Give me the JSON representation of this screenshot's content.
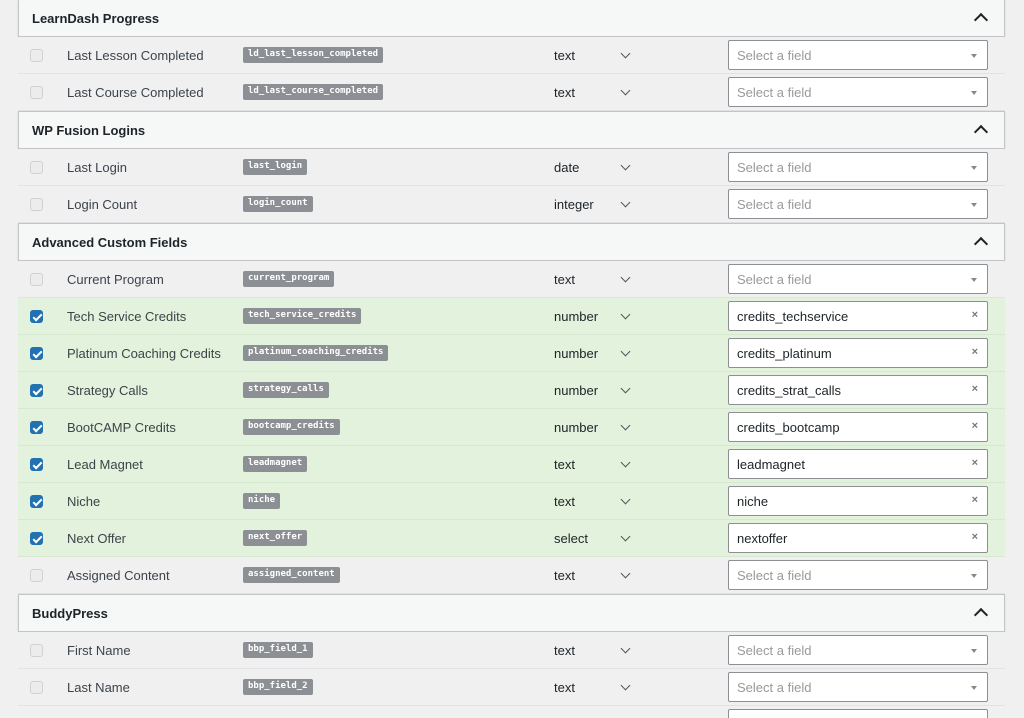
{
  "placeholder": "Select a field",
  "sections": [
    {
      "title": "LearnDash Progress",
      "rows": [
        {
          "label": "Last Lesson Completed",
          "key": "ld_last_lesson_completed",
          "type": "text",
          "checked": false,
          "value": ""
        },
        {
          "label": "Last Course Completed",
          "key": "ld_last_course_completed",
          "type": "text",
          "checked": false,
          "value": ""
        }
      ]
    },
    {
      "title": "WP Fusion Logins",
      "rows": [
        {
          "label": "Last Login",
          "key": "last_login",
          "type": "date",
          "checked": false,
          "value": ""
        },
        {
          "label": "Login Count",
          "key": "login_count",
          "type": "integer",
          "checked": false,
          "value": ""
        }
      ]
    },
    {
      "title": "Advanced Custom Fields",
      "rows": [
        {
          "label": "Current Program",
          "key": "current_program",
          "type": "text",
          "checked": false,
          "value": ""
        },
        {
          "label": "Tech Service Credits",
          "key": "tech_service_credits",
          "type": "number",
          "checked": true,
          "value": "credits_techservice"
        },
        {
          "label": "Platinum Coaching Credits",
          "key": "platinum_coaching_credits",
          "type": "number",
          "checked": true,
          "value": "credits_platinum"
        },
        {
          "label": "Strategy Calls",
          "key": "strategy_calls",
          "type": "number",
          "checked": true,
          "value": "credits_strat_calls"
        },
        {
          "label": "BootCAMP Credits",
          "key": "bootcamp_credits",
          "type": "number",
          "checked": true,
          "value": "credits_bootcamp"
        },
        {
          "label": "Lead Magnet",
          "key": "leadmagnet",
          "type": "text",
          "checked": true,
          "value": "leadmagnet"
        },
        {
          "label": "Niche",
          "key": "niche",
          "type": "text",
          "checked": true,
          "value": "niche"
        },
        {
          "label": "Next Offer",
          "key": "next_offer",
          "type": "select",
          "checked": true,
          "value": "nextoffer"
        },
        {
          "label": "Assigned Content",
          "key": "assigned_content",
          "type": "text",
          "checked": false,
          "value": ""
        }
      ]
    },
    {
      "title": "BuddyPress",
      "rows": [
        {
          "label": "First Name",
          "key": "bbp_field_1",
          "type": "text",
          "checked": false,
          "value": ""
        },
        {
          "label": "Last Name",
          "key": "bbp_field_2",
          "type": "text",
          "checked": false,
          "value": ""
        },
        {
          "label": "",
          "key": "",
          "type": "",
          "checked": false,
          "value": ""
        }
      ]
    }
  ]
}
